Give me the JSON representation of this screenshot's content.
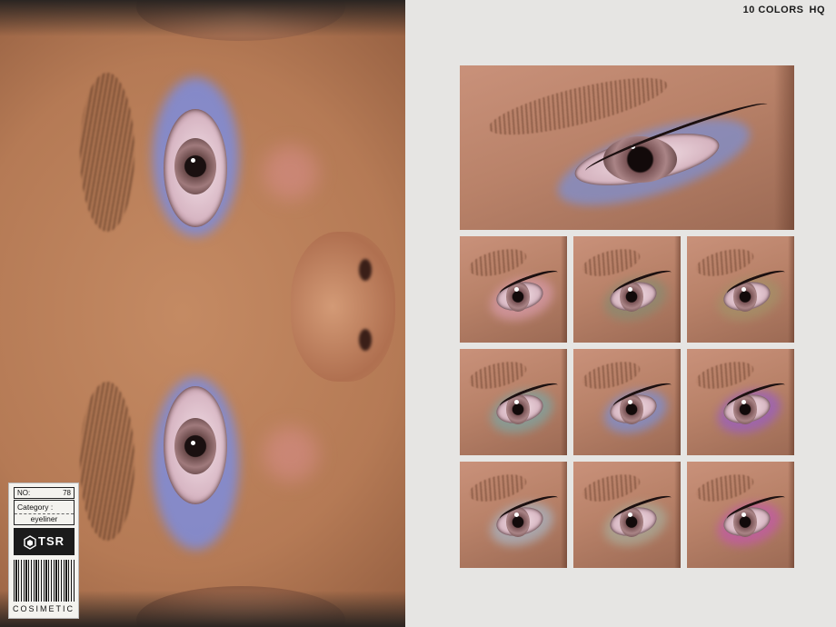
{
  "header": {
    "colors": "10 COLORS",
    "quality": "HQ"
  },
  "label": {
    "no_label": "NO:",
    "no_value": "78",
    "category_label": "Category :",
    "category_value": "eyeliner",
    "logo": "TSR",
    "footer": "COSIMETIC"
  },
  "swatches": [
    {
      "color": "#7e8fd0"
    },
    {
      "color": "#d79aa7"
    },
    {
      "color": "#8b8a70"
    },
    {
      "color": "#a49068"
    },
    {
      "color": "#7fa3a0"
    },
    {
      "color": "#7e8fd0"
    },
    {
      "color": "#9a5fc0"
    },
    {
      "color": "#a9b3c0"
    },
    {
      "color": "#a9aa98"
    },
    {
      "color": "#c25aa6"
    }
  ]
}
